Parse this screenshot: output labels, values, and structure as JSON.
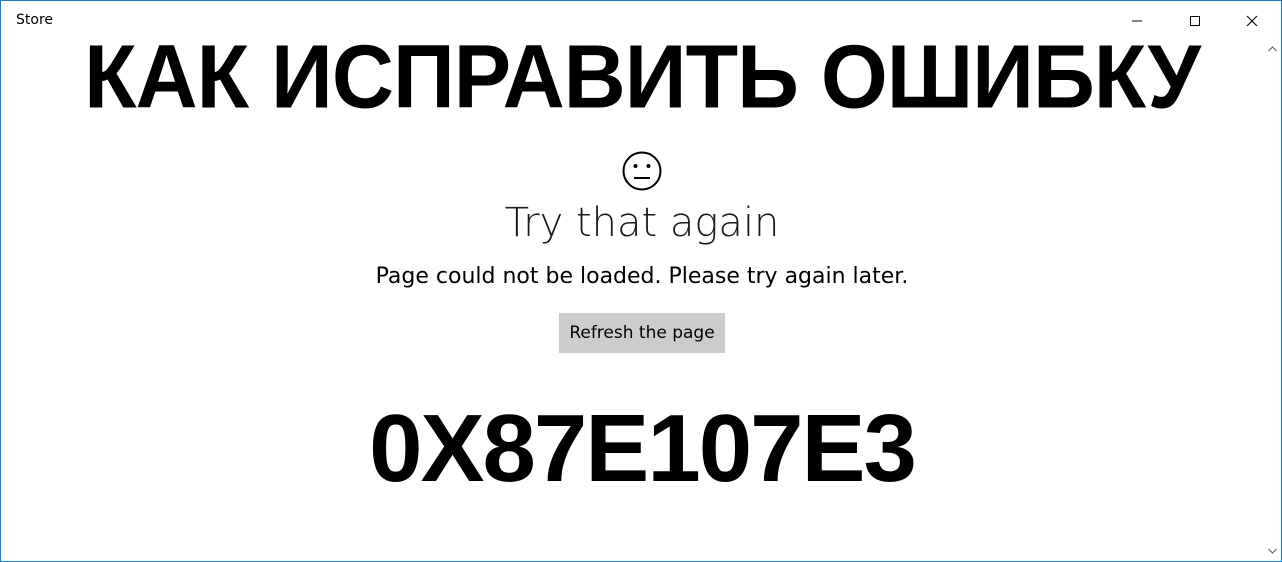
{
  "window": {
    "title": "Store",
    "controls": {
      "minimize_icon": "minimize-icon",
      "maximize_icon": "maximize-icon",
      "close_icon": "close-icon"
    },
    "border_color": "#1979ca"
  },
  "overlay": {
    "headline": "КАК ИСПРАВИТЬ ОШИБКУ",
    "error_code": "0X87E107E3"
  },
  "error_page": {
    "icon": "sad-face-icon",
    "heading": "Try that again",
    "message": "Page could not be loaded. Please try again later.",
    "refresh_label": "Refresh the page",
    "button_color": "#cccccc"
  },
  "scrollbar": {
    "up_icon": "scroll-up-arrow-icon",
    "down_icon": "scroll-down-arrow-icon"
  }
}
